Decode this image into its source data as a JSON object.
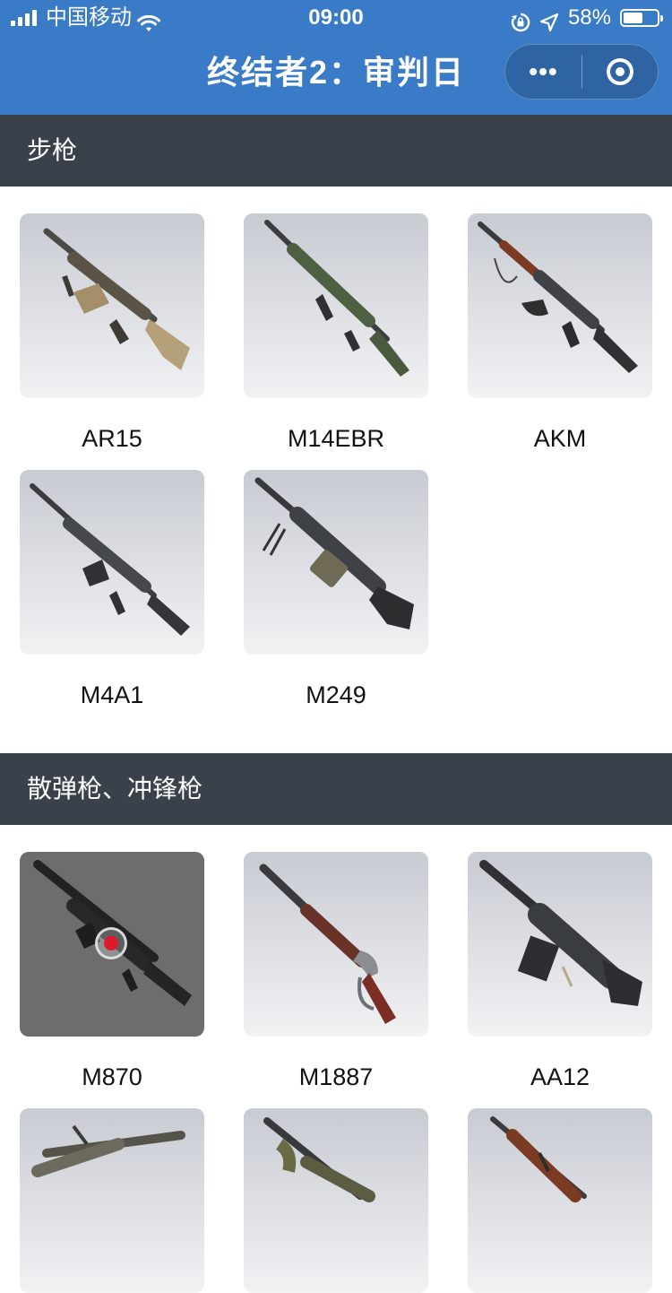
{
  "status_bar": {
    "carrier": "中国移动",
    "time": "09:00",
    "battery": "58%",
    "battery_level": 0.58
  },
  "nav": {
    "title": "终结者2：审判日",
    "more_label": "•••"
  },
  "sections": [
    {
      "title": "步枪",
      "items": [
        "AR15",
        "M14EBR",
        "AKM",
        "M4A1",
        "M249"
      ]
    },
    {
      "title": "散弹枪、冲锋枪",
      "items": [
        "M870",
        "M1887",
        "AA12"
      ]
    }
  ],
  "icons": {
    "signal": "signal-icon",
    "wifi": "wifi-icon",
    "rotation_lock": "rotation-lock-icon",
    "location": "location-arrow-icon",
    "battery": "battery-icon",
    "more": "more-icon",
    "close": "close-target-icon"
  }
}
